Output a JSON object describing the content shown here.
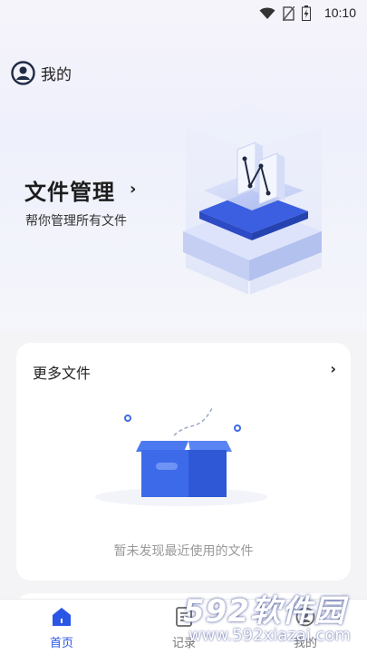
{
  "status": {
    "time": "10:10"
  },
  "header": {
    "profile_label": "我的"
  },
  "hero": {
    "title": "文件管理",
    "subtitle": "帮你管理所有文件",
    "chevron": "›"
  },
  "recent_card": {
    "title": "更多文件",
    "chevron": "›",
    "empty_text": "暂未发现最近使用的文件"
  },
  "tabs": [
    {
      "label": "首页",
      "active": true
    },
    {
      "label": "记录",
      "active": false
    },
    {
      "label": "我的",
      "active": false
    }
  ],
  "watermark": {
    "logo": "592软件园",
    "url": "www.592xiazai.com"
  },
  "colors": {
    "accent": "#2a56e6",
    "box": "#3d6ae8"
  }
}
